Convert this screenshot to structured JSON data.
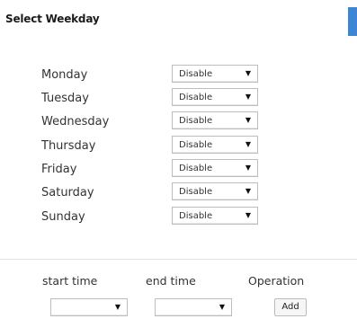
{
  "header": {
    "title": "Select Weekday"
  },
  "colors": {
    "accent": "#3d86d4"
  },
  "days": [
    {
      "label": "Monday",
      "value": "Disable"
    },
    {
      "label": "Tuesday",
      "value": "Disable"
    },
    {
      "label": "Wednesday",
      "value": "Disable"
    },
    {
      "label": "Thursday",
      "value": "Disable"
    },
    {
      "label": "Friday",
      "value": "Disable"
    },
    {
      "label": "Saturday",
      "value": "Disable"
    },
    {
      "label": "Sunday",
      "value": "Disable"
    }
  ],
  "dropdown_arrow": "▼",
  "schedule": {
    "start_label": "start time",
    "end_label": "end time",
    "operation_label": "Operation",
    "start_value": "",
    "end_value": "",
    "add_label": "Add"
  }
}
